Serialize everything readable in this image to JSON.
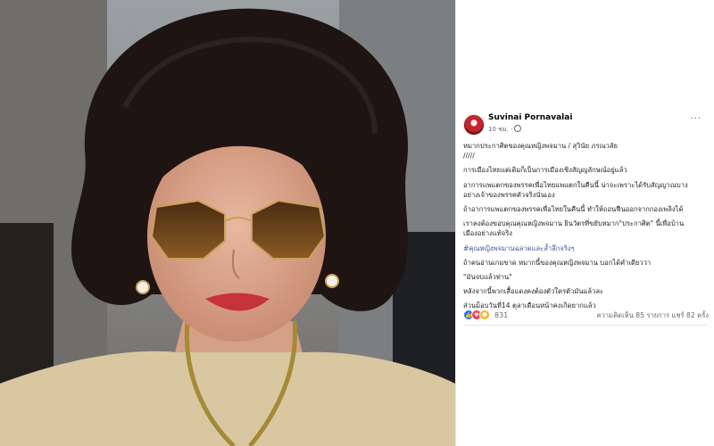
{
  "post": {
    "author": "Suvinai Pornavalai",
    "time": "10 ชม. ·",
    "more": "···",
    "lines": [
      "หมากประกาศิตของคุณหญิงพจมาน / สุวินัย ภรณวลัย",
      "/////",
      "การเมืองไทยแต่เดิมก็เป็นการเมืองเชิงสัญญลักษณ์อยู่แล้ว",
      "อาการแพแตกของพรรคเพื่อไทยแพแตกในคืนนี้ น่าจะเพราะได้รับสัญญาณบาง",
      "อย่างเจ้าของพรรคตัวจริงนั่นเอง",
      "ถ้าอาการแพแตกของพรรคเพื่อไทยในคืนนี้ ทำให้ถอนฟืนออกจากกองเพลิงได้",
      "เราคงต้องขอบคุณคุณหญิงพจมาน ยินวัตรที่ขยับหมาก\"ประกาศิต\" นี้เพื่อบ้าน",
      "เมืองอย่างแท้จริง",
      "#คุณหญิงพจมานฉลาดและล้ำลึกจริงๆ",
      "ถ้าคนอ่านเกมขาด หมากนี้ของคุณหญิงพจมาน บอกได้คำเดียวว่า",
      "\"มันจบแล้วท่าน\"",
      "หลังจากนี้พวกเสื้อแดงคงต้องตัวใครตัวมันแล้วละ",
      "ส่วนม็อบวันที่14 ตุลาเดือนหน้าคงเกิดยากแล้ว"
    ],
    "reactions": [
      "like-icon",
      "love-icon",
      "haha-icon"
    ],
    "reaction_count": "831",
    "stats": "ความคิดเห็น 85 รายการ  แชร์ 82 ครั้ง"
  },
  "colors": {
    "accent": "#385898",
    "muted": "#65676b",
    "text": "#1c1e21"
  }
}
